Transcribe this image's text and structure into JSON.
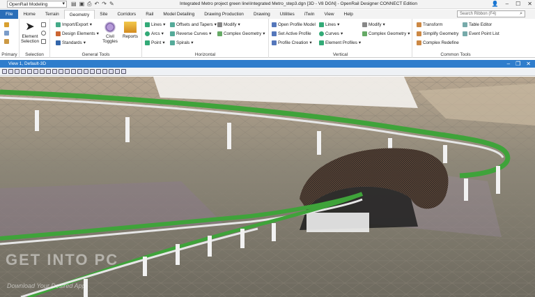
{
  "titlebar": {
    "workspace": "OpenRail Modeling",
    "title": "Integrated Metro project green line\\Integrated Metro_step3.dgn [3D - V8 DGN] - OpenRail Designer CONNECT Edition"
  },
  "tabs": [
    "File",
    "Home",
    "Terrain",
    "Geometry",
    "Site",
    "Corridors",
    "Rail",
    "Model Detailing",
    "Drawing Production",
    "Drawing",
    "Utilities",
    "iTwin",
    "View",
    "Help"
  ],
  "search": {
    "placeholder": "Search Ribbon (F4)"
  },
  "ribbon": {
    "primary": {
      "label": "Primary"
    },
    "selection": {
      "element_selection": "Element Selection",
      "label": "Selection"
    },
    "general": {
      "import_export": "Import/Export",
      "design_elements": "Design Elements",
      "standards": "Standards",
      "civil_toggles": "Civil Toggles",
      "reports": "Reports",
      "label": "General Tools"
    },
    "horizontal": {
      "lines": "Lines",
      "arcs": "Arcs",
      "point": "Point",
      "offsets": "Offsets and Tapers",
      "reverse_curves": "Reverse Curves",
      "spirals": "Spirals",
      "modify": "Modify",
      "complex_geometry": "Complex Geometry",
      "label": "Horizontal"
    },
    "vertical": {
      "open_profile": "Open Profile Model",
      "set_active": "Set Active Profile",
      "profile_creation": "Profile Creation",
      "lines": "Lines",
      "curves": "Curves",
      "element_profiles": "Element Profiles",
      "modify": "Modify",
      "complex_geometry": "Complex Geometry",
      "label": "Vertical"
    },
    "common": {
      "transform": "Transform",
      "simplify": "Simplify Geometry",
      "complex_redefine": "Complex Redefine",
      "table_editor": "Table Editor",
      "event_point_list": "Event Point List",
      "label": "Common Tools"
    }
  },
  "view": {
    "title": "View 1, Default-3D"
  },
  "watermark": {
    "main": "GET INTO PC",
    "sub": "Download Your Desired App"
  },
  "colors": {
    "file_tab": "#2a6eb8",
    "view_bar": "#2f7dcc",
    "track_green": "#3fa33a"
  }
}
